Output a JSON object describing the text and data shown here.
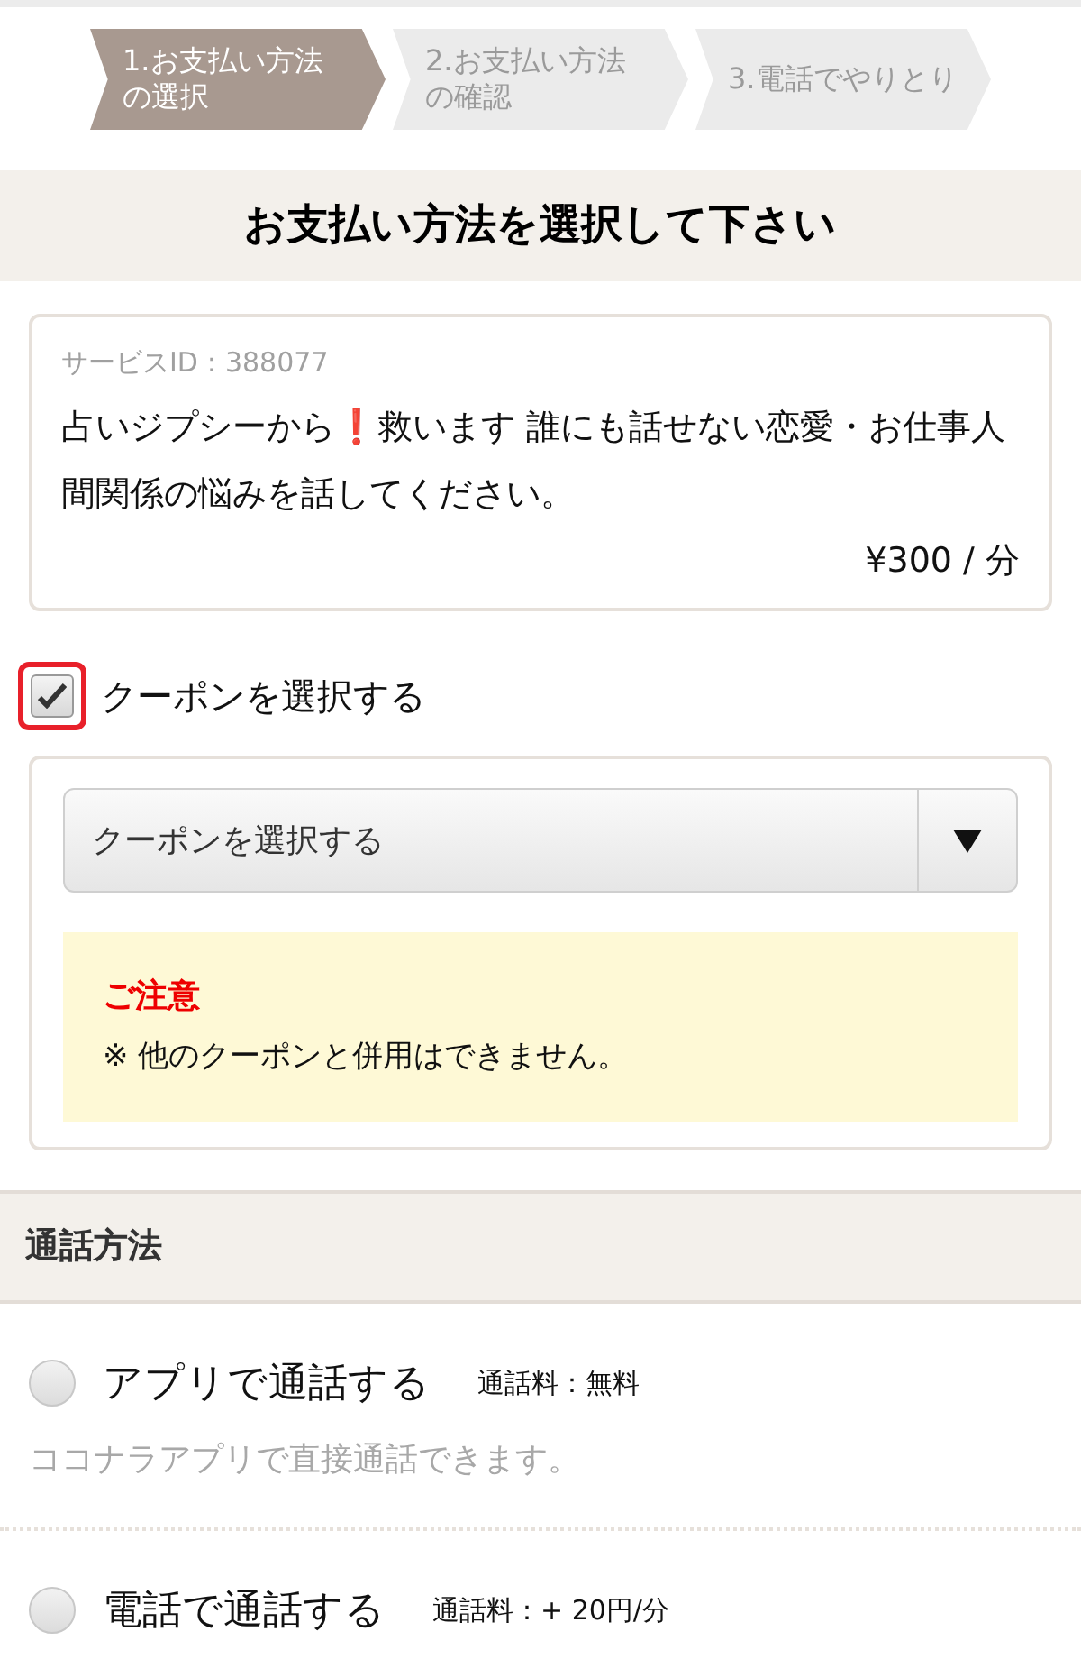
{
  "steps": [
    {
      "label_lines": [
        "1.お支払い方法",
        "の選択"
      ],
      "selected": true
    },
    {
      "label_lines": [
        "2.お支払い方法",
        "の確認"
      ],
      "selected": false
    },
    {
      "label_lines": [
        "3.電話でやりとり"
      ],
      "selected": false
    }
  ],
  "title": "お支払い方法を選択して下さい",
  "service": {
    "id_label": "サービスID：388077",
    "description": {
      "before": "占いジプシーから",
      "mark": "❗",
      "after": "救います 誰にも話せない恋愛・お仕事人間関係の悩みを話してください。"
    },
    "price": "¥300 / 分"
  },
  "coupon": {
    "label": "クーポンを選択する",
    "checked": true,
    "select_value": "クーポンを選択する",
    "notice_title": "ご注意",
    "notice_text": "※ 他のクーポンと併用はできません。"
  },
  "call_method": {
    "heading": "通話方法",
    "options": [
      {
        "label": "アプリで通話する",
        "fee": "通話料：無料",
        "note": "ココナラアプリで直接通話できます。",
        "selected": false
      },
      {
        "label": "電話で通話する",
        "fee": "通話料：+ 20円/分",
        "selected": false
      }
    ]
  }
}
